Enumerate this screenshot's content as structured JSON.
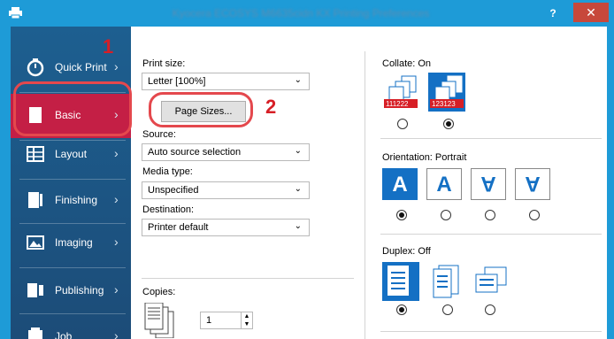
{
  "window": {
    "title": "Kyocera ECOSYS M6635cidn KX Printing Preferences",
    "help": "?",
    "close": "✕"
  },
  "sidebar": {
    "items": [
      {
        "label": "Quick Print",
        "icon": "stopwatch-icon"
      },
      {
        "label": "Basic",
        "icon": "page-icon",
        "active": true
      },
      {
        "label": "Layout",
        "icon": "layout-icon"
      },
      {
        "label": "Finishing",
        "icon": "finishing-icon"
      },
      {
        "label": "Imaging",
        "icon": "image-icon"
      },
      {
        "label": "Publishing",
        "icon": "publishing-icon"
      },
      {
        "label": "Job",
        "icon": "job-icon"
      }
    ]
  },
  "basic": {
    "print_size_label": "Print size:",
    "print_size_value": "Letter  [100%]",
    "page_sizes_button": "Page Sizes...",
    "source_label": "Source:",
    "source_value": "Auto source selection",
    "media_type_label": "Media type:",
    "media_type_value": "Unspecified",
    "destination_label": "Destination:",
    "destination_value": "Printer default",
    "copies_label": "Copies:",
    "copies_value": "1"
  },
  "collate": {
    "label": "Collate:  On",
    "tray1": "111222",
    "tray2": "123123"
  },
  "orientation": {
    "label": "Orientation:  Portrait",
    "glyph": "A"
  },
  "duplex": {
    "label": "Duplex:  Off"
  },
  "annotations": {
    "step1": "1",
    "step2": "2",
    "color": "#d71f26"
  },
  "colors": {
    "titlebar": "#1e9bd7",
    "sidebar": "#1c5583",
    "active": "#c41f45",
    "accent": "#1470c4"
  }
}
